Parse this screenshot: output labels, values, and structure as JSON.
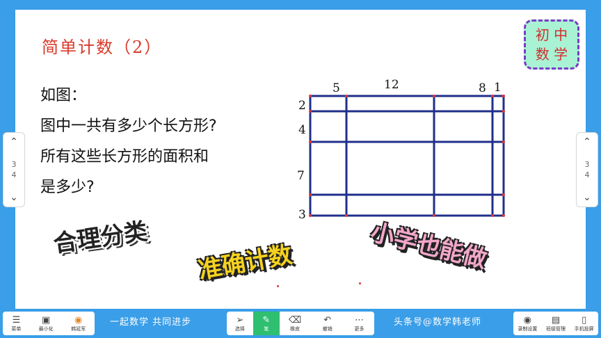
{
  "slide": {
    "title": "简单计数（2）",
    "badge": [
      "初 中",
      "数 学"
    ],
    "question": [
      "如图：",
      "图中一共有多少个长方形?",
      "所有这些长方形的面积和",
      "是多少?"
    ],
    "figure": {
      "top_labels": [
        "5",
        "12",
        "8",
        "1"
      ],
      "left_labels": [
        "2",
        "4",
        "7",
        "3"
      ]
    },
    "stamps": [
      "合理分类",
      "准确计数",
      "小学也能做"
    ]
  },
  "nav": {
    "left": {
      "page_top": "3",
      "page_bottom": "4"
    },
    "right": {
      "page_top": "3",
      "page_bottom": "4"
    }
  },
  "toolbar": {
    "left_buttons": [
      {
        "label": "菜单",
        "icon": "menu-icon"
      },
      {
        "label": "最小化",
        "icon": "minimize-icon"
      },
      {
        "label": "韩延军",
        "icon": "avatar-icon"
      }
    ],
    "slogan_left": "一起数学  共同进步",
    "center_buttons": [
      {
        "label": "选择",
        "icon": "cursor-icon"
      },
      {
        "label": "笔",
        "icon": "pen-icon"
      },
      {
        "label": "橡皮",
        "icon": "eraser-icon"
      },
      {
        "label": "撤销",
        "icon": "undo-icon"
      },
      {
        "label": "更多",
        "icon": "more-icon"
      }
    ],
    "slogan_right": "头条号@数学韩老师",
    "right_buttons": [
      {
        "label": "录制设置",
        "icon": "record-icon"
      },
      {
        "label": "班级管理",
        "icon": "class-icon"
      },
      {
        "label": "手机投屏",
        "icon": "phone-icon"
      }
    ]
  },
  "colors": {
    "background": "#3a9ee8",
    "title": "#d93a2b",
    "grid": "#1f2f8a",
    "active_tool": "#2fbf71"
  }
}
